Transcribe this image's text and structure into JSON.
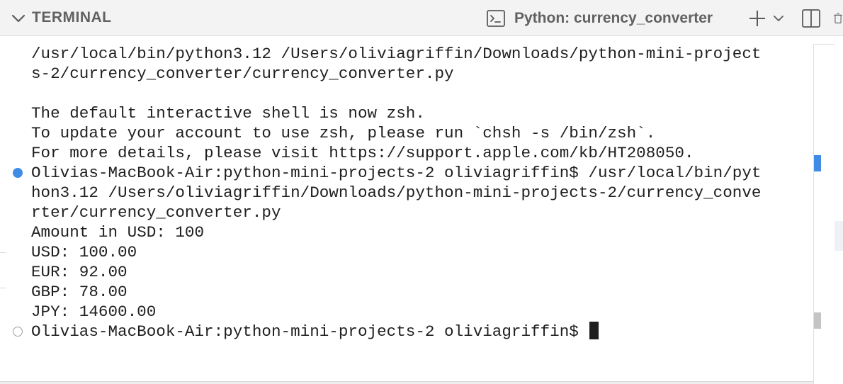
{
  "panel": {
    "title": "TERMINAL",
    "collapse_icon": "chevron-down-icon"
  },
  "terminal_tab": {
    "label": "Python: currency_converter",
    "icon": "terminal-icon"
  },
  "actions": {
    "new_terminal_icon": "plus-icon",
    "launch_profile_icon": "chevron-down-icon",
    "split_icon": "split-icon",
    "kill_icon": "trash-icon"
  },
  "terminal": {
    "lines": [
      "/usr/local/bin/python3.12 /Users/oliviagriffin/Downloads/python-mini-project",
      "s-2/currency_converter/currency_converter.py",
      "",
      "The default interactive shell is now zsh.",
      "To update your account to use zsh, please run `chsh -s /bin/zsh`.",
      "For more details, please visit https://support.apple.com/kb/HT208050.",
      "Olivias-MacBook-Air:python-mini-projects-2 oliviagriffin$ /usr/local/bin/pyt",
      "hon3.12 /Users/oliviagriffin/Downloads/python-mini-projects-2/currency_conve",
      "rter/currency_converter.py",
      "Amount in USD: 100",
      "USD: 100.00",
      "EUR: 92.00",
      "GBP: 78.00",
      "JPY: 14600.00",
      "Olivias-MacBook-Air:python-mini-projects-2 oliviagriffin$ "
    ],
    "decorations": [
      {
        "line": 6,
        "status": "success",
        "icon": "success-dot-icon"
      },
      {
        "line": 14,
        "status": "pending",
        "icon": "pending-circle-icon"
      }
    ]
  },
  "colors": {
    "header_bg": "#f3f3f3",
    "header_text": "#616161",
    "terminal_text": "#1f1f1f",
    "accent": "#3f8be6"
  }
}
